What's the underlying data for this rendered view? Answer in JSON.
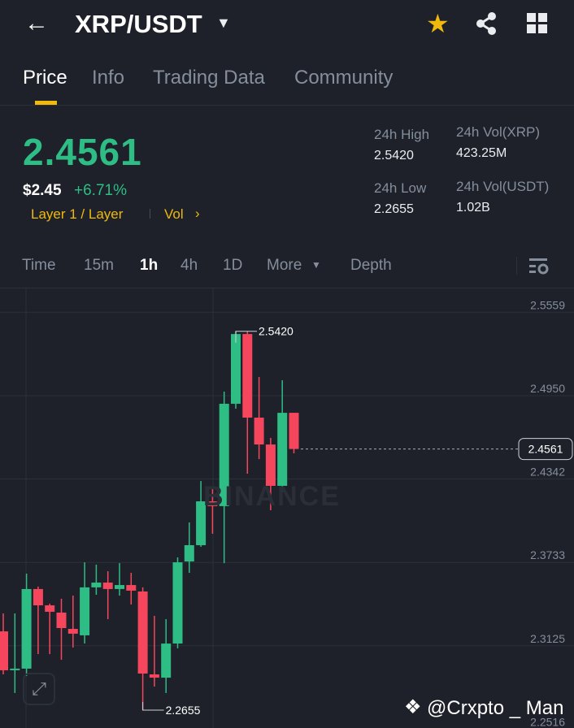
{
  "header": {
    "title": "XRP/USDT"
  },
  "tabs": [
    "Price",
    "Info",
    "Trading Data",
    "Community"
  ],
  "ticker": {
    "last_price": "2.4561",
    "usd_price": "$2.45",
    "change": "+6.71%",
    "tag": "Layer 1 / Layer",
    "vol_link": "Vol",
    "high_label": "24h High",
    "high": "2.5420",
    "low_label": "24h Low",
    "low": "2.2655",
    "vol_xrp_label": "24h Vol(XRP)",
    "vol_xrp": "423.25M",
    "vol_usdt_label": "24h Vol(USDT)",
    "vol_usdt": "1.02B"
  },
  "timeframes": [
    "Time",
    "15m",
    "1h",
    "4h",
    "1D",
    "More",
    "Depth"
  ],
  "active_timeframe": "1h",
  "watermark": "BINANCE",
  "credit": "@Crxpto _ Man",
  "colors": {
    "up": "#2ebd85",
    "down": "#f6465d",
    "accent": "#f0b90b"
  },
  "chart_data": {
    "type": "candlestick",
    "interval": "1h",
    "y_ticks": [
      "2.5559",
      "2.4950",
      "2.4342",
      "2.3733",
      "2.3125",
      "2.2516"
    ],
    "ylim": [
      2.2516,
      2.5559
    ],
    "current_price": "2.4561",
    "high_label": "2.5420",
    "low_label": "2.2655",
    "candles": [
      [
        2.323,
        2.3361,
        2.2916,
        2.2946
      ],
      [
        2.2952,
        2.3361,
        2.278,
        2.2958
      ],
      [
        2.2958,
        2.3651,
        2.2904,
        2.3539
      ],
      [
        2.3539,
        2.3557,
        2.3064,
        2.342
      ],
      [
        2.342,
        2.3432,
        2.3064,
        2.3373
      ],
      [
        2.3367,
        2.3468,
        2.3023,
        2.3254
      ],
      [
        2.3248,
        2.3491,
        2.3112,
        2.3213
      ],
      [
        2.3201,
        2.3734,
        2.3141,
        2.3551
      ],
      [
        2.3551,
        2.3717,
        2.3497,
        2.3586
      ],
      [
        2.3586,
        2.3669,
        2.3319,
        2.3539
      ],
      [
        2.3539,
        2.3728,
        2.3491,
        2.3568
      ],
      [
        2.3568,
        2.3657,
        2.3426,
        2.3527
      ],
      [
        2.3521,
        2.3551,
        2.2655,
        2.2922
      ],
      [
        2.2916,
        2.3343,
        2.2827,
        2.2892
      ],
      [
        2.2892,
        2.3319,
        2.278,
        2.3141
      ],
      [
        2.3141,
        2.377,
        2.3106,
        2.3734
      ],
      [
        2.374,
        2.4025,
        2.3657,
        2.3859
      ],
      [
        2.3859,
        2.4327,
        2.3847,
        2.4179
      ],
      [
        2.4179,
        2.428,
        2.3942,
        2.4144
      ],
      [
        2.4144,
        2.498,
        2.3728,
        2.4891
      ],
      [
        2.4891,
        2.542,
        2.4855,
        2.54
      ],
      [
        2.54,
        2.542,
        2.4381,
        2.479
      ],
      [
        2.479,
        2.5086,
        2.4487,
        2.4594
      ],
      [
        2.4594,
        2.4642,
        2.4114,
        2.4292
      ],
      [
        2.4292,
        2.5063,
        2.425,
        2.4825
      ],
      [
        2.4825,
        2.4825,
        2.4529,
        2.4561
      ]
    ]
  }
}
